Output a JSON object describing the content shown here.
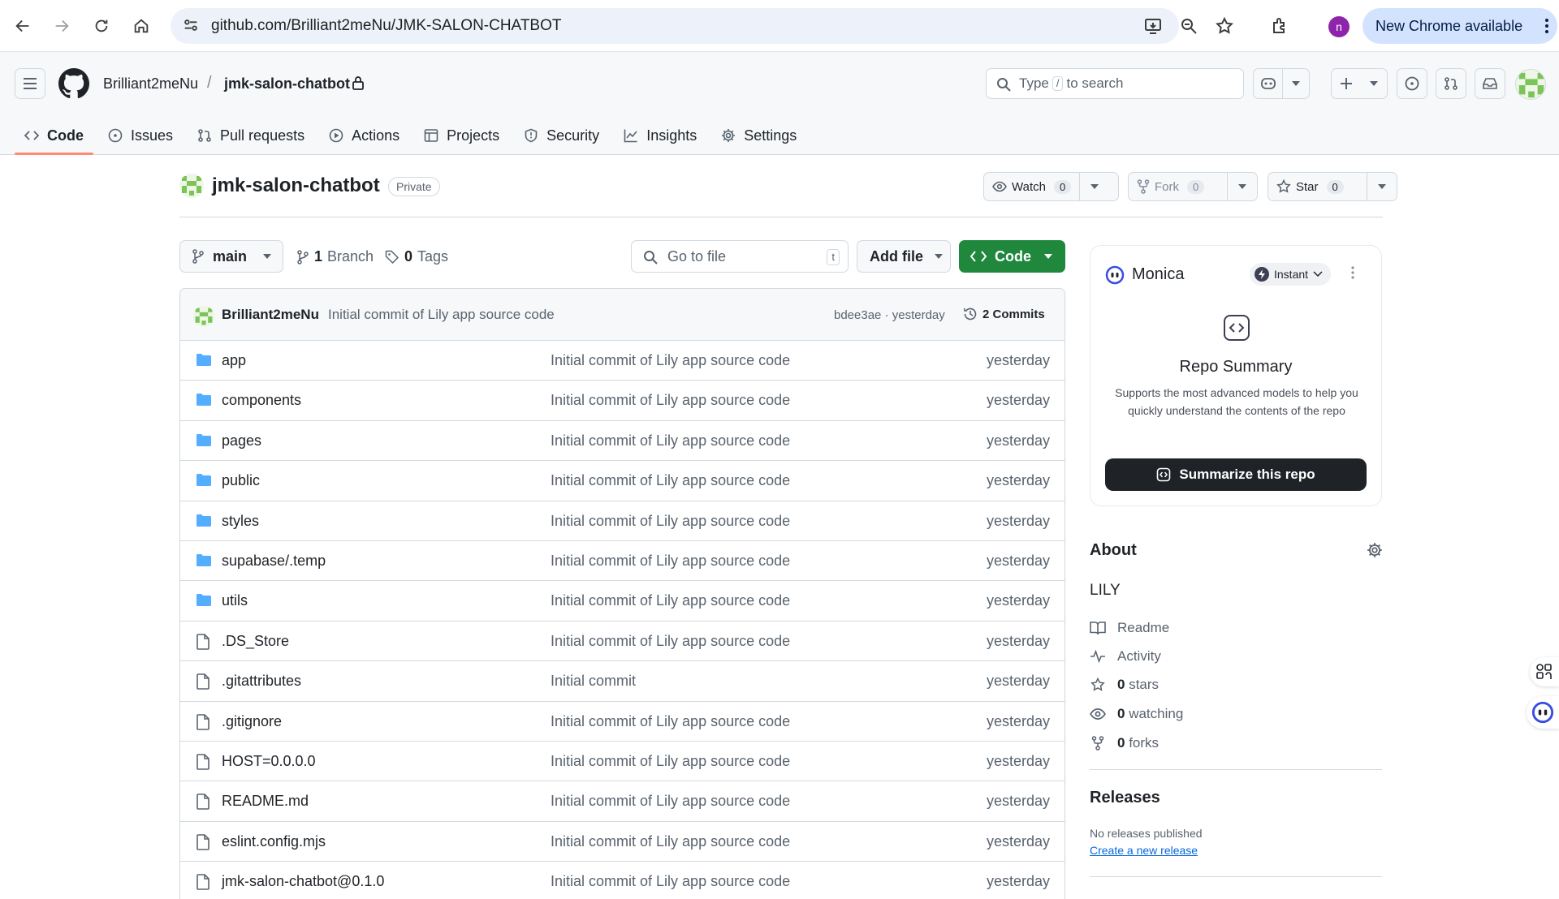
{
  "browser": {
    "url": "github.com/Brilliant2meNu/JMK-SALON-CHATBOT",
    "profile_initial": "n",
    "update_label": "New Chrome available"
  },
  "header": {
    "owner": "Brilliant2meNu",
    "separator": "/",
    "repo": "jmk-salon-chatbot",
    "search_pre": "Type",
    "search_key": "/",
    "search_post": "to search"
  },
  "tabs": [
    {
      "label": "Code",
      "icon": "code-icon"
    },
    {
      "label": "Issues",
      "icon": "issue-icon"
    },
    {
      "label": "Pull requests",
      "icon": "pull-request-icon"
    },
    {
      "label": "Actions",
      "icon": "play-icon"
    },
    {
      "label": "Projects",
      "icon": "table-icon"
    },
    {
      "label": "Security",
      "icon": "shield-icon"
    },
    {
      "label": "Insights",
      "icon": "graph-icon"
    },
    {
      "label": "Settings",
      "icon": "gear-icon"
    }
  ],
  "repo": {
    "name": "jmk-salon-chatbot",
    "visibility": "Private",
    "watch_label": "Watch",
    "watch_count": "0",
    "fork_label": "Fork",
    "fork_count": "0",
    "star_label": "Star",
    "star_count": "0"
  },
  "toolbar": {
    "branch": "main",
    "branch_count": "1",
    "branch_label": "Branch",
    "tag_count": "0",
    "tag_label": "Tags",
    "goto_placeholder": "Go to file",
    "goto_key": "t",
    "add_file": "Add file",
    "code": "Code"
  },
  "latest_commit": {
    "author": "Brilliant2meNu",
    "message": "Initial commit of Lily app source code",
    "hash_time": "bdee3ae · yesterday",
    "commits": "2 Commits"
  },
  "files": [
    {
      "name": "app",
      "type": "folder",
      "message": "Initial commit of Lily app source code",
      "date": "yesterday"
    },
    {
      "name": "components",
      "type": "folder",
      "message": "Initial commit of Lily app source code",
      "date": "yesterday"
    },
    {
      "name": "pages",
      "type": "folder",
      "message": "Initial commit of Lily app source code",
      "date": "yesterday"
    },
    {
      "name": "public",
      "type": "folder",
      "message": "Initial commit of Lily app source code",
      "date": "yesterday"
    },
    {
      "name": "styles",
      "type": "folder",
      "message": "Initial commit of Lily app source code",
      "date": "yesterday"
    },
    {
      "name": "supabase/.temp",
      "type": "folder",
      "message": "Initial commit of Lily app source code",
      "date": "yesterday"
    },
    {
      "name": "utils",
      "type": "folder",
      "message": "Initial commit of Lily app source code",
      "date": "yesterday"
    },
    {
      "name": ".DS_Store",
      "type": "file",
      "message": "Initial commit of Lily app source code",
      "date": "yesterday"
    },
    {
      "name": ".gitattributes",
      "type": "file",
      "message": "Initial commit",
      "date": "yesterday"
    },
    {
      "name": ".gitignore",
      "type": "file",
      "message": "Initial commit of Lily app source code",
      "date": "yesterday"
    },
    {
      "name": "HOST=0.0.0.0",
      "type": "file",
      "message": "Initial commit of Lily app source code",
      "date": "yesterday"
    },
    {
      "name": "README.md",
      "type": "file",
      "message": "Initial commit of Lily app source code",
      "date": "yesterday"
    },
    {
      "name": "eslint.config.mjs",
      "type": "file",
      "message": "Initial commit of Lily app source code",
      "date": "yesterday"
    },
    {
      "name": "jmk-salon-chatbot@0.1.0",
      "type": "file",
      "message": "Initial commit of Lily app source code",
      "date": "yesterday"
    }
  ],
  "monica": {
    "title": "Monica",
    "mode": "Instant",
    "heading": "Repo Summary",
    "description": "Supports the most advanced models to help you quickly understand the contents of the repo",
    "button": "Summarize this repo"
  },
  "about": {
    "heading": "About",
    "description": "LILY",
    "readme": "Readme",
    "activity": "Activity",
    "stars_count": "0",
    "stars_label": "stars",
    "watching_count": "0",
    "watching_label": "watching",
    "forks_count": "0",
    "forks_label": "forks"
  },
  "releases": {
    "heading": "Releases",
    "none": "No releases published",
    "create": "Create a new release"
  },
  "colors": {
    "accent_green": "#1f883d",
    "tab_underline": "#fd8c73",
    "folder_blue": "#54aeff",
    "link_blue": "#0969da"
  }
}
